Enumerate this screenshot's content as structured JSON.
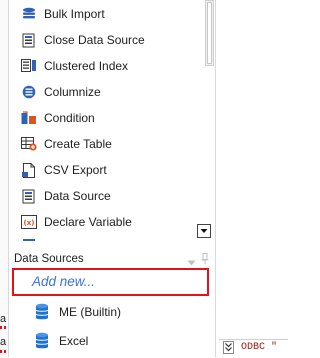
{
  "toolbox": {
    "items": [
      {
        "label": "Bulk Import",
        "icon": "bulk-import-icon"
      },
      {
        "label": "Close Data Source",
        "icon": "close-data-source-icon"
      },
      {
        "label": "Clustered Index",
        "icon": "clustered-index-icon"
      },
      {
        "label": "Columnize",
        "icon": "columnize-icon"
      },
      {
        "label": "Condition",
        "icon": "condition-icon"
      },
      {
        "label": "Create Table",
        "icon": "create-table-icon"
      },
      {
        "label": "CSV Export",
        "icon": "csv-export-icon"
      },
      {
        "label": "Data Source",
        "icon": "data-source-icon"
      },
      {
        "label": "Declare Variable",
        "icon": "declare-variable-icon"
      }
    ]
  },
  "data_sources": {
    "title": "Data Sources",
    "add_new": "Add new...",
    "items": [
      {
        "label": "ME (Builtin)",
        "icon": "database-icon"
      },
      {
        "label": "Excel",
        "icon": "database-icon"
      }
    ]
  },
  "editor": {
    "left_fragments": [
      "a",
      "a"
    ],
    "code_fragment": "ODBC  \""
  },
  "colors": {
    "highlight_border": "#e0121c",
    "add_new_text": "#3b73d8",
    "db_icon": "#1f73d0"
  }
}
